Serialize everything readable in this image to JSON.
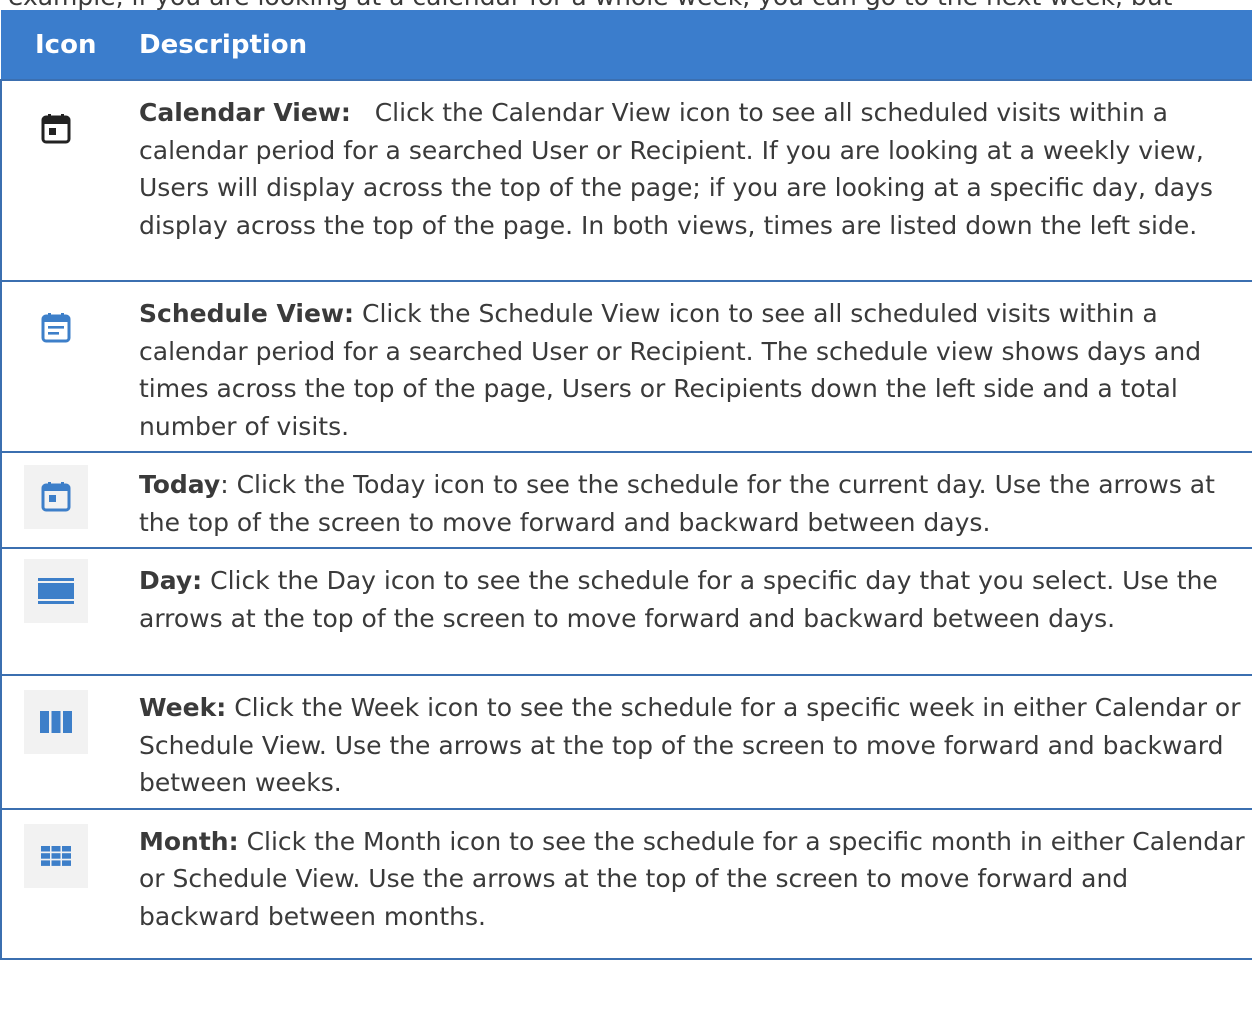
{
  "cutoff_text": "example, if you are looking at a calendar for a whole week, you can go to the next week, but",
  "table": {
    "headers": {
      "icon": "Icon",
      "description": "Description"
    },
    "rows": [
      {
        "icon": "calendar-view-icon",
        "term": "Calendar View:",
        "sep": "   ",
        "text": "Click the Calendar View icon to see all scheduled visits within a calendar period for a searched User or Recipient. If you are looking at a weekly view, Users will display across the top of the page; if you are looking at a specific day, days display across the top of the page. In both views, times are listed down the left side."
      },
      {
        "icon": "schedule-view-icon",
        "term": "Schedule View:",
        "sep": " ",
        "text": "Click the Schedule View icon to see all scheduled visits within a calendar period for a searched User or Recipient. The schedule view shows days and times across the top of the page, Users or Recipients down the left side and a total number of visits."
      },
      {
        "icon": "today-icon",
        "term": "Today",
        "sep": ": ",
        "text": "Click the Today icon to see the schedule for the current day. Use the arrows at the top of the screen to move forward and backward between days."
      },
      {
        "icon": "day-icon",
        "term": "Day:",
        "sep": " ",
        "text": "Click the Day icon to see the schedule for a specific day that you select. Use the arrows at the top of the screen to move forward and backward between days."
      },
      {
        "icon": "week-icon",
        "term": "Week:",
        "sep": " ",
        "text": "Click the Week icon to see the schedule for a specific week in either Calendar or Schedule View. Use the arrows at the top of the screen to move forward and backward between weeks."
      },
      {
        "icon": "month-icon",
        "term": "Month:",
        "sep": " ",
        "text": "Click the Month icon to see the schedule for a specific month in either Calendar or Schedule View.  Use the arrows at the top of the screen to move forward and backward between months."
      }
    ]
  },
  "colors": {
    "header_bg": "#3b7dcc",
    "border": "#3b6fb0",
    "icon_dark": "#222222",
    "icon_blue": "#3d7fc9"
  }
}
